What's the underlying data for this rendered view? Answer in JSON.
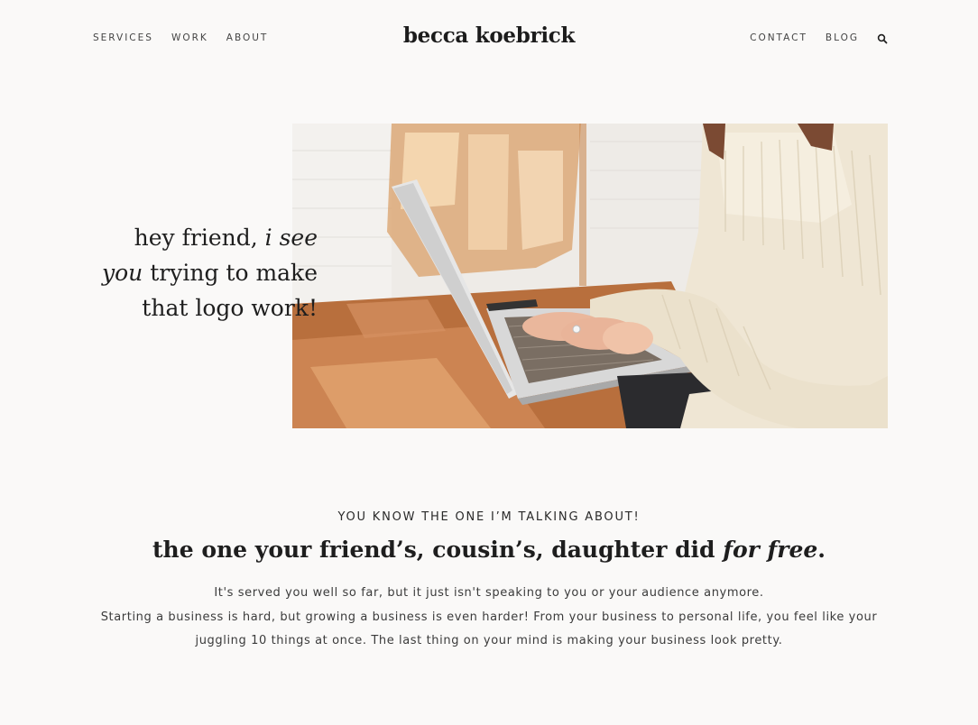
{
  "header": {
    "logo": "becca koebrick",
    "nav_left": [
      "SERVICES",
      "WORK",
      "ABOUT"
    ],
    "nav_right": [
      "CONTACT",
      "BLOG"
    ],
    "search_icon": "search-icon"
  },
  "hero": {
    "line1_plain": "hey friend, ",
    "line1_italic": "i see",
    "line2_italic": "you",
    "line2_plain": " trying to make",
    "line3": "that logo work!",
    "image": "woman in cream sweater typing on laptop at wooden desk"
  },
  "intro": {
    "eyebrow": "YOU KNOW THE ONE I’M TALKING ABOUT!",
    "headline_plain": "the one your friend’s, cousin’s, daughter did ",
    "headline_italic": "for free",
    "headline_end": ".",
    "paragraph1": "It's served you well so far, but it just isn't speaking to you or your audience anymore.",
    "paragraph2": "Starting a business is hard, but growing a business is even harder! From your business to personal life, you feel like your juggling 10 things at once. The last thing on your mind is making your business look pretty."
  },
  "colors": {
    "background": "#faf9f8",
    "text": "#1e1e1e",
    "sweater": "#efe6d4",
    "desk": "#c5814f"
  }
}
